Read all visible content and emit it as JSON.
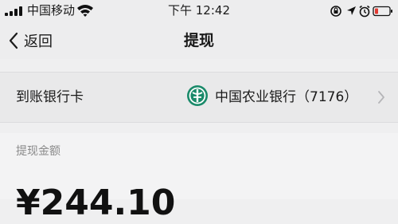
{
  "status_bar": {
    "carrier": "中国移动",
    "time": "下午 12:42",
    "icons": [
      "signal-bars",
      "wifi",
      "orientation-lock",
      "location-arrow",
      "alarm-clock",
      "battery-low"
    ]
  },
  "nav": {
    "back_label": "返回",
    "title": "提现"
  },
  "card_row": {
    "label": "到账银行卡",
    "bank_name": "中国农业银行（7176）",
    "bank_logo_color": "#1a8a6a"
  },
  "amount": {
    "label": "提现金额",
    "value": "¥244.10"
  },
  "colors": {
    "background": "#efeff0",
    "battery_low": "#e23a32"
  }
}
